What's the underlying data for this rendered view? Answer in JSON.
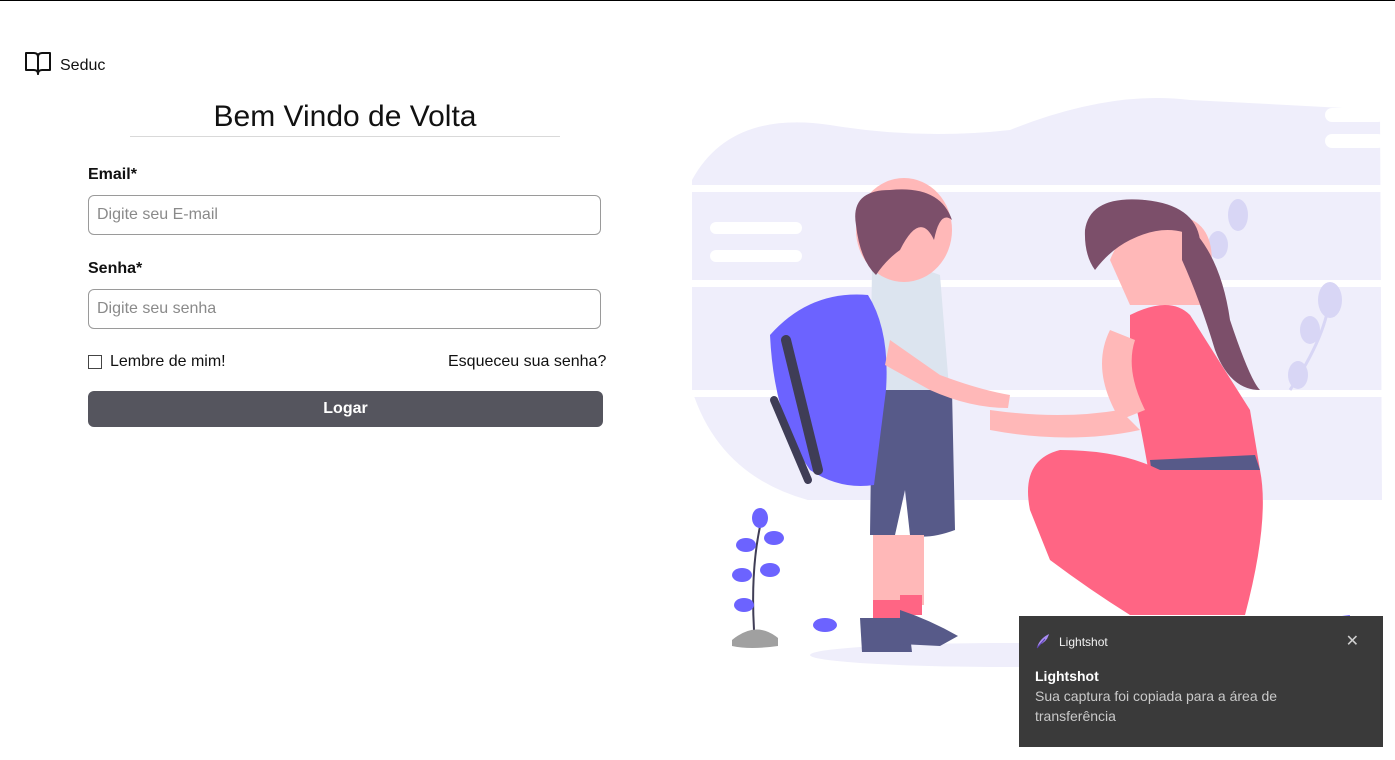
{
  "brand": {
    "name": "Seduc",
    "icon": "open-book-icon"
  },
  "form": {
    "title": "Bem Vindo de Volta",
    "email_label": "Email*",
    "email_placeholder": "Digite seu E-mail",
    "password_label": "Senha*",
    "password_placeholder": "Digite seu senha",
    "remember_label": "Lembre de mim!",
    "forgot_label": "Esqueceu sua senha?",
    "submit_label": "Logar"
  },
  "notification": {
    "app_name": "Lightshot",
    "app_icon": "feather-icon",
    "title": "Lightshot",
    "message": "Sua captura foi copiada para a área de transferência",
    "close_icon": "close-icon"
  },
  "colors": {
    "button": "#55555e",
    "illustration_accent": "#6c63ff",
    "dress": "#ff6584",
    "toast_bg": "#3a3a3a"
  }
}
